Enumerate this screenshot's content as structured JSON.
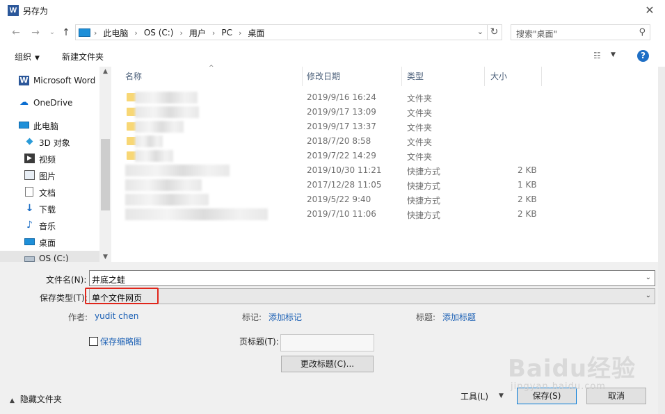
{
  "window": {
    "title": "另存为",
    "app_icon_letter": "W"
  },
  "address": {
    "crumbs": [
      "此电脑",
      "OS (C:)",
      "用户",
      "PC",
      "桌面"
    ],
    "search_placeholder": "搜索\"桌面\""
  },
  "toolbar": {
    "organize": "组织",
    "new_folder": "新建文件夹"
  },
  "sidebar": {
    "items": [
      {
        "label": "Microsoft Word",
        "icon": "word-icon"
      },
      {
        "label": "OneDrive",
        "icon": "cloud-icon"
      },
      {
        "label": "此电脑",
        "icon": "pc-icon"
      },
      {
        "label": "3D 对象",
        "icon": "cube-icon"
      },
      {
        "label": "视频",
        "icon": "video-icon"
      },
      {
        "label": "图片",
        "icon": "picture-icon"
      },
      {
        "label": "文档",
        "icon": "document-icon"
      },
      {
        "label": "下载",
        "icon": "download-icon"
      },
      {
        "label": "音乐",
        "icon": "music-icon"
      },
      {
        "label": "桌面",
        "icon": "desktop-icon"
      },
      {
        "label": "OS (C:)",
        "icon": "drive-icon"
      }
    ],
    "selected": "OS (C:)"
  },
  "files": {
    "columns": [
      "名称",
      "修改日期",
      "类型",
      "大小"
    ],
    "rows": [
      {
        "date": "2019/9/16 16:24",
        "type": "文件夹",
        "size": ""
      },
      {
        "date": "2019/9/17 13:09",
        "type": "文件夹",
        "size": ""
      },
      {
        "date": "2019/9/17 13:37",
        "type": "文件夹",
        "size": ""
      },
      {
        "date": "2018/7/20 8:58",
        "type": "文件夹",
        "size": ""
      },
      {
        "date": "2019/7/22 14:29",
        "type": "文件夹",
        "size": ""
      },
      {
        "date": "2019/10/30 11:21",
        "type": "快捷方式",
        "size": "2 KB"
      },
      {
        "date": "2017/12/28 11:05",
        "type": "快捷方式",
        "size": "1 KB"
      },
      {
        "date": "2019/5/22 9:40",
        "type": "快捷方式",
        "size": "2 KB"
      },
      {
        "date": "2019/7/10 11:06",
        "type": "快捷方式",
        "size": "2 KB"
      }
    ]
  },
  "form": {
    "filename_label": "文件名(N):",
    "filename_value": "井底之蛙",
    "filetype_label": "保存类型(T):",
    "filetype_value": "单个文件网页",
    "author_label": "作者:",
    "author_value": "yudit chen",
    "tags_label": "标记:",
    "tags_link": "添加标记",
    "title_label": "标题:",
    "title_link": "添加标题",
    "thumbnail_label": "保存缩略图",
    "pagetitle_label": "页标题(T):",
    "change_title_button": "更改标题(C)..."
  },
  "footer": {
    "hide_folders": "隐藏文件夹",
    "tools": "工具(L)",
    "save": "保存(S)",
    "cancel": "取消"
  },
  "watermark": {
    "text": "Baidu经验",
    "sub": "jingyan.baidu.com"
  }
}
